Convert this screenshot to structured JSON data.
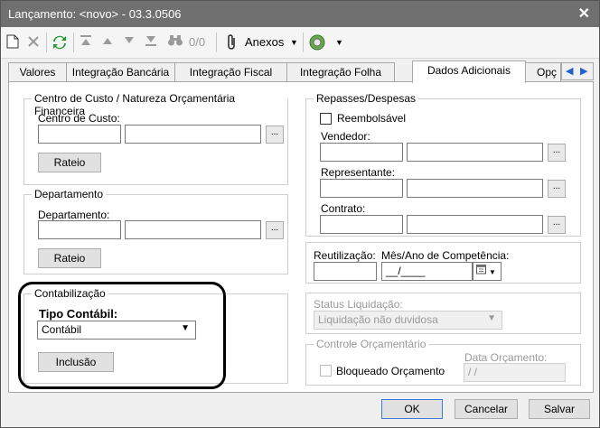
{
  "window": {
    "title": "Lançamento: <novo> - 03.3.0506",
    "close_glyph": "✕"
  },
  "toolbar": {
    "counter": "0/0",
    "attachments_label": "Anexos",
    "icons": [
      "new-doc-icon",
      "delete-icon",
      "refresh-icon",
      "first-record-icon",
      "prev-record-icon",
      "next-record-icon",
      "last-record-icon",
      "binoculars-icon",
      "paperclip-icon",
      "plugin-icon"
    ]
  },
  "tabs": [
    {
      "label": "Valores"
    },
    {
      "label": "Integração Bancária"
    },
    {
      "label": "Integração Fiscal"
    },
    {
      "label": "Integração Folha"
    },
    {
      "label": "Dados Adicionais"
    },
    {
      "label": "Opç"
    }
  ],
  "cost_center": {
    "group_title": "Centro de Custo / Natureza Orçamentária Financeira",
    "field_label": "Centro de Custo:",
    "code_value": "",
    "desc_value": "",
    "lookup_label": "...",
    "button_label": "Rateio"
  },
  "department": {
    "group_title": "Departamento",
    "field_label": "Departamento:",
    "code_value": "",
    "desc_value": "",
    "lookup_label": "...",
    "button_label": "Rateio"
  },
  "accounting": {
    "group_title": "Contabilização",
    "type_label": "Tipo Contábil:",
    "type_value": "Contábil",
    "button_label": "Inclusão"
  },
  "transfers": {
    "group_title": "Repasses/Despesas",
    "reimbursable_label": "Reembolsável",
    "reimbursable_checked": false,
    "seller_label": "Vendedor:",
    "representative_label": "Representante:",
    "contract_label": "Contrato:",
    "lookup_label": "..."
  },
  "reuse": {
    "reuse_label": "Reutilização:",
    "reuse_value": "",
    "competence_label": "Mês/Ano de Competência:",
    "competence_value": "__/____"
  },
  "settlement": {
    "label": "Status Liquidação:",
    "value": "Liquidação não duvidosa"
  },
  "budget": {
    "group_title": "Controle Orçamentário",
    "blocked_label": "Bloqueado Orçamento",
    "blocked_checked": false,
    "date_label": "Data Orçamento:",
    "date_value": " /  / "
  },
  "footer": {
    "ok_label": "OK",
    "cancel_label": "Cancelar",
    "save_label": "Salvar"
  },
  "colors": {
    "titlebar": "#707070",
    "highlight": "#000000",
    "refresh_green": "#1a9a2a",
    "tab_arrow_blue": "#2060d0"
  }
}
